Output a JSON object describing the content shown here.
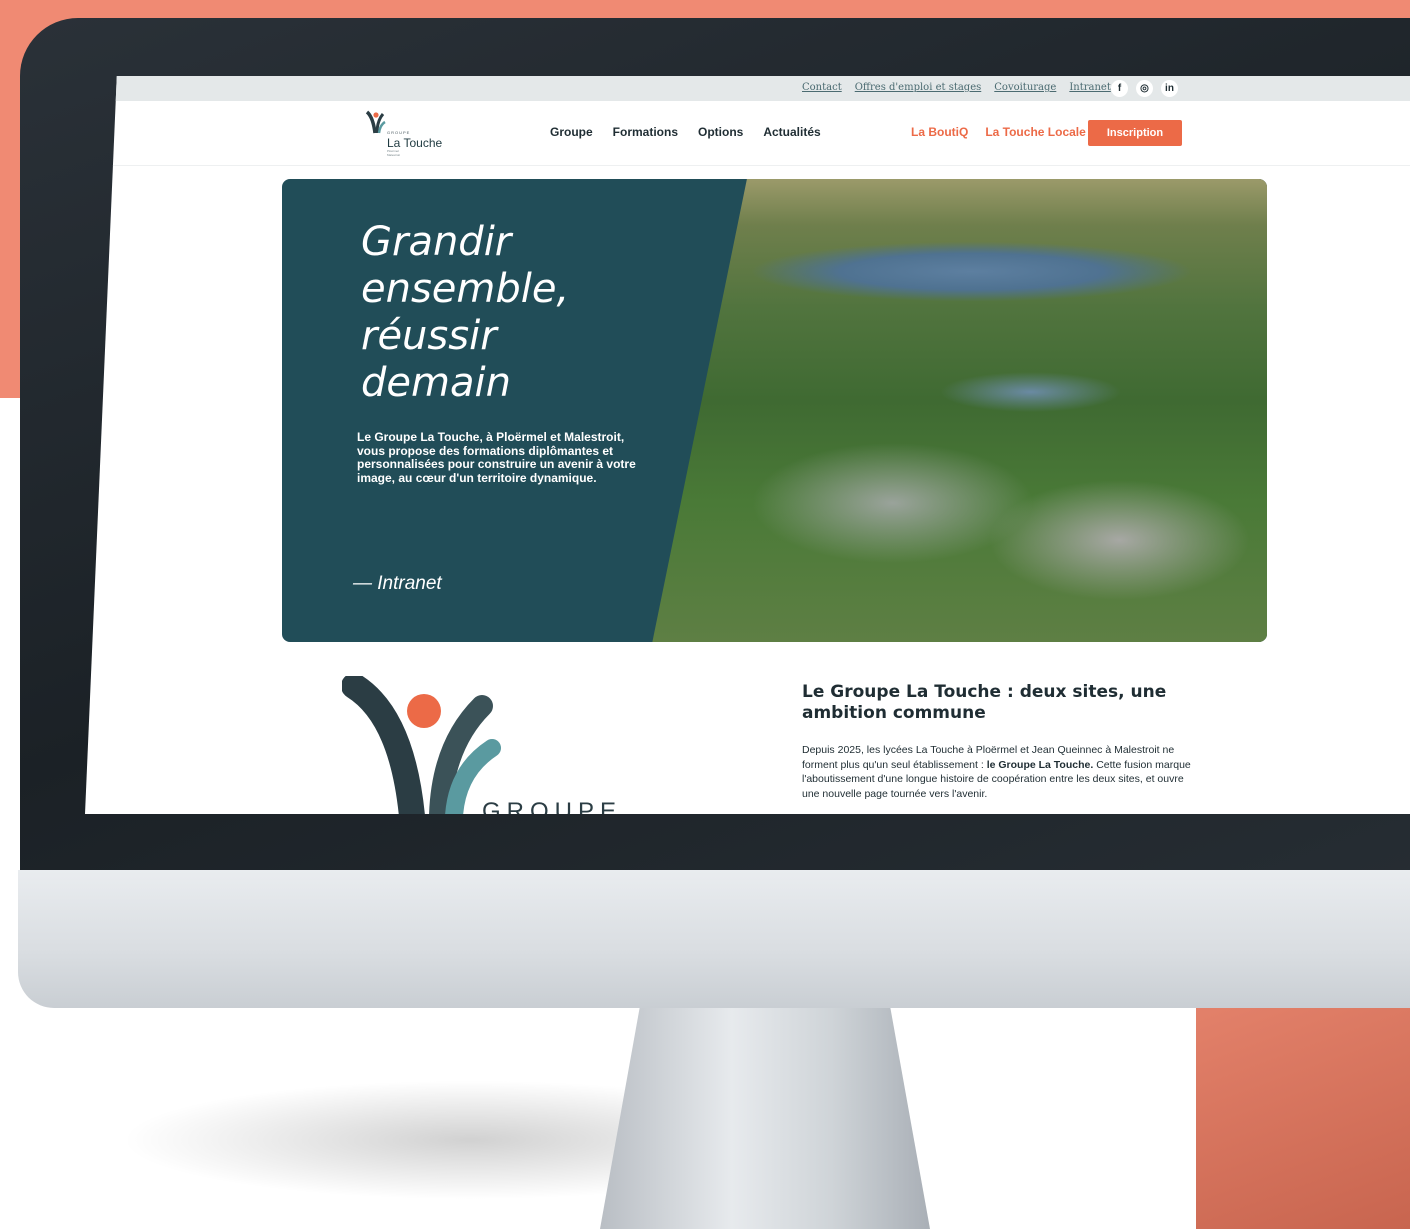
{
  "util_bar": {
    "links": [
      "Contact",
      "Offres d'emploi et stages",
      "Covoiturage",
      "Intranet"
    ],
    "social": [
      {
        "icon": "facebook-icon",
        "glyph": "f"
      },
      {
        "icon": "instagram-icon",
        "glyph": "◎"
      },
      {
        "icon": "linkedin-icon",
        "glyph": "in"
      }
    ]
  },
  "nav": {
    "logo": {
      "prefix": "GROUPE",
      "name": "La Touche",
      "sub": "Ploërmel Malestroit"
    },
    "main_items": [
      "Groupe",
      "Formations",
      "Options",
      "Actualités"
    ],
    "accent_items": [
      "La BoutiQ",
      "La Touche Locale"
    ],
    "cta": "Inscription"
  },
  "hero": {
    "title_lines": [
      "Grandir",
      "ensemble,",
      "réussir",
      "demain"
    ],
    "description": "Le Groupe La Touche, à Ploërmel et Malestroit, vous propose des formations diplômantes et personnalisées pour construire un avenir à votre image, au cœur d'un territoire dynamique.",
    "link": "— Intranet"
  },
  "about": {
    "title": "Le Groupe La Touche : deux sites, une ambition commune",
    "text_start": "Depuis 2025, les lycées La Touche à Ploërmel et Jean Queinnec à Malestroit ne forment plus qu'un seul établissement : ",
    "text_bold": "le Groupe La Touche.",
    "text_end": " Cette fusion marque l'aboutissement d'une longue histoire de coopération entre les deux sites, et ouvre une nouvelle page tournée vers l'avenir.",
    "logo_word": "GROUPE"
  },
  "colors": {
    "accent": "#ec6a47",
    "hero_panel": "#214d58",
    "background_salmon": "#f08a73"
  }
}
